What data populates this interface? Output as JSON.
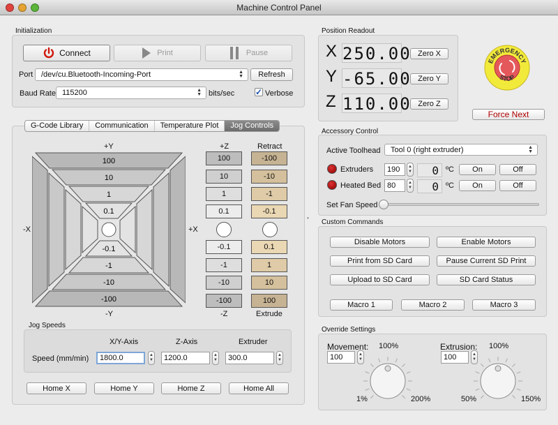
{
  "window": {
    "title": "Machine Control Panel",
    "traffic_lights": {
      "close": "#e0443e",
      "minimize": "#e5a432",
      "zoom": "#5bb53a"
    }
  },
  "initialization": {
    "title": "Initialization",
    "connect_label": "Connect",
    "print_label": "Print",
    "pause_label": "Pause",
    "port_label": "Port",
    "port_value": "/dev/cu.Bluetooth-Incoming-Port",
    "refresh_label": "Refresh",
    "baud_label": "Baud Rate",
    "baud_value": "115200",
    "baud_unit": "bits/sec",
    "verbose_label": "Verbose",
    "verbose_checked": true,
    "power_icon_color": "#d0180b"
  },
  "tabs": [
    {
      "label": "G-Code Library",
      "active": false
    },
    {
      "label": "Communication",
      "active": false
    },
    {
      "label": "Temperature Plot",
      "active": false
    },
    {
      "label": "Jog Controls",
      "active": true
    }
  ],
  "jog": {
    "plus_y": "+Y",
    "minus_y": "-Y",
    "plus_x": "+X",
    "minus_x": "-X",
    "y_steps_up": [
      "100",
      "10",
      "1",
      "0.1"
    ],
    "y_steps_down": [
      "-0.1",
      "-1",
      "-10",
      "-100"
    ],
    "z_title_top": "+Z",
    "z_title_bottom": "-Z",
    "z_steps": [
      "100",
      "10",
      "1",
      "0.1",
      "-0.1",
      "-1",
      "-10",
      "-100"
    ],
    "e_title_top": "Retract",
    "e_title_bottom": "Extrude",
    "e_steps": [
      "-100",
      "-10",
      "-1",
      "-0.1",
      "0.1",
      "1",
      "10",
      "100"
    ]
  },
  "jog_speeds": {
    "title": "Jog Speeds",
    "row_label": "Speed (mm/min)",
    "columns": [
      {
        "header": "X/Y-Axis",
        "value": "1800.0"
      },
      {
        "header": "Z-Axis",
        "value": "1200.0"
      },
      {
        "header": "Extruder",
        "value": "300.0"
      }
    ]
  },
  "home_buttons": [
    "Home X",
    "Home Y",
    "Home Z",
    "Home All"
  ],
  "position": {
    "title": "Position Readout",
    "axes": [
      {
        "axis": "X",
        "value": "250.00",
        "zero_label": "Zero X"
      },
      {
        "axis": "Y",
        "value": "-65.00",
        "zero_label": "Zero Y"
      },
      {
        "axis": "Z",
        "value": "110.00",
        "zero_label": "Zero Z"
      }
    ]
  },
  "emergency": {
    "top_text": "EMERGENCY",
    "bottom_text": "STOP",
    "force_next_label": "Force Next",
    "force_next_color": "#b00000"
  },
  "accessory": {
    "title": "Accessory Control",
    "toolhead_label": "Active Toolhead",
    "toolhead_value": "Tool 0 (right extruder)",
    "rows": [
      {
        "label": "Extruders",
        "setpoint": "190",
        "reading": "0",
        "unit": "ºC",
        "on": "On",
        "off": "Off"
      },
      {
        "label": "Heated Bed",
        "setpoint": "80",
        "reading": "0",
        "unit": "ºC",
        "on": "On",
        "off": "Off"
      }
    ],
    "fan_label": "Set Fan Speed",
    "fan_value": 0
  },
  "custom": {
    "title": "Custom Commands",
    "buttons": [
      "Disable Motors",
      "Enable Motors",
      "Print from SD Card",
      "Pause Current SD Print",
      "Upload to SD Card",
      "SD Card Status"
    ],
    "macros": [
      "Macro 1",
      "Macro 2",
      "Macro 3"
    ]
  },
  "override": {
    "title": "Override Settings",
    "movement": {
      "label": "Movement:",
      "value": "100",
      "top": "100%",
      "min": "1%",
      "max": "200%"
    },
    "extrusion": {
      "label": "Extrusion:",
      "value": "100",
      "top": "100%",
      "min": "50%",
      "max": "150%"
    }
  }
}
